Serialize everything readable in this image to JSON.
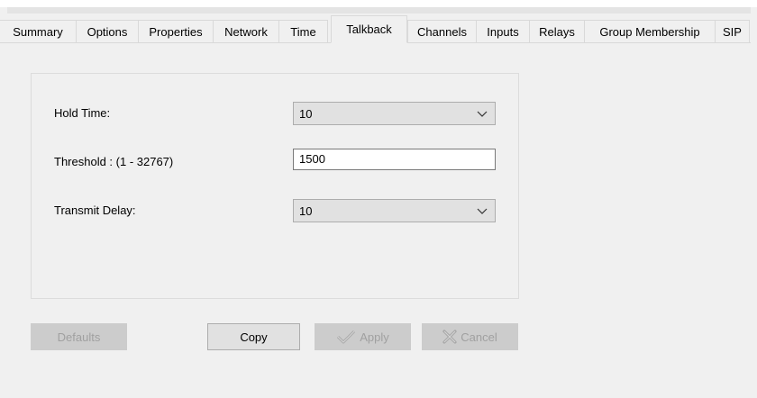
{
  "tabs": [
    {
      "label": "Summary",
      "active": false
    },
    {
      "label": "Options",
      "active": false
    },
    {
      "label": "Properties",
      "active": false
    },
    {
      "label": "Network",
      "active": false
    },
    {
      "label": "Time",
      "active": false
    },
    {
      "label": "Talkback",
      "active": true
    },
    {
      "label": "Channels",
      "active": false
    },
    {
      "label": "Inputs",
      "active": false
    },
    {
      "label": "Relays",
      "active": false
    },
    {
      "label": "Group Membership",
      "active": false
    },
    {
      "label": "SIP",
      "active": false
    }
  ],
  "form": {
    "hold_time": {
      "label": "Hold Time:",
      "value": "10"
    },
    "threshold": {
      "label": "Threshold : (1 - 32767)",
      "value": "1500"
    },
    "transmit_delay": {
      "label": "Transmit Delay:",
      "value": "10"
    }
  },
  "buttons": {
    "defaults": {
      "label": "Defaults",
      "enabled": false
    },
    "copy": {
      "label": "Copy",
      "enabled": true
    },
    "apply": {
      "label": "Apply",
      "enabled": false,
      "icon": "check-icon"
    },
    "cancel": {
      "label": "Cancel",
      "enabled": false,
      "icon": "x-icon"
    }
  },
  "colors": {
    "window_bg": "#f0f0f0",
    "combo_bg": "#e1e1e1",
    "disabled_bg": "#cccccc",
    "disabled_text": "#a0a0a0"
  }
}
